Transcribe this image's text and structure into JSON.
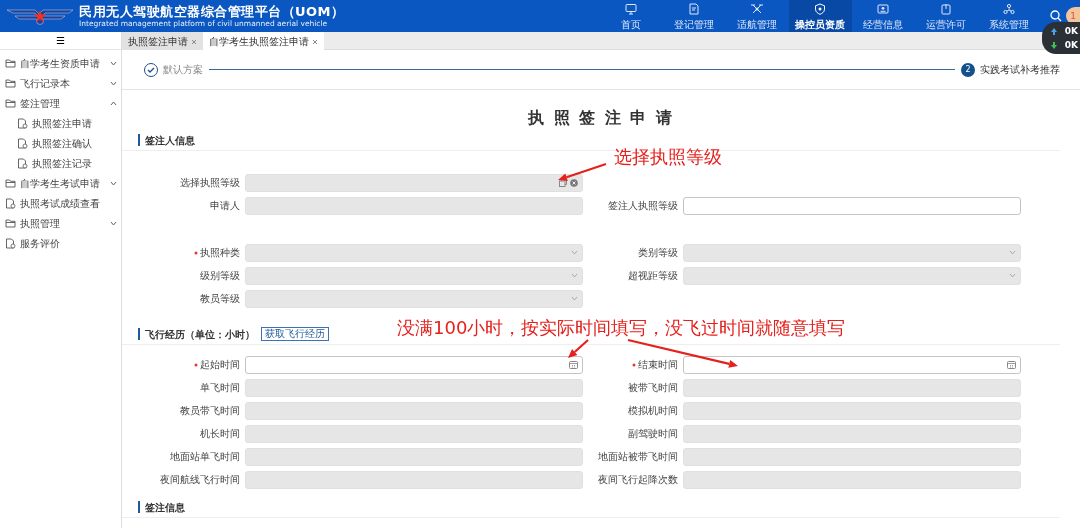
{
  "header": {
    "title": "民用无人驾驶航空器综合管理平台（UOM）",
    "subtitle": "Integrated management platform of civil unmanned aerial vehicle",
    "nav": [
      {
        "label": "首页",
        "selected": false
      },
      {
        "label": "登记管理",
        "selected": false
      },
      {
        "label": "适航管理",
        "selected": false
      },
      {
        "label": "操控员资质",
        "selected": true
      },
      {
        "label": "经营信息",
        "selected": false
      },
      {
        "label": "运营许可",
        "selected": false
      },
      {
        "label": "系统管理",
        "selected": false
      }
    ],
    "avatar": "1",
    "speed": [
      {
        "kind": "up",
        "text": "0K"
      },
      {
        "kind": "down",
        "text": "0K"
      }
    ]
  },
  "tabs": [
    {
      "label": "执照签注申请",
      "selected": false
    },
    {
      "label": "自学考生执照签注申请",
      "selected": true
    }
  ],
  "sidebar": {
    "menu_icon": "☰",
    "items": [
      {
        "label": "自学考生资质申请",
        "kind": "folder",
        "expanded": false
      },
      {
        "label": "飞行记录本",
        "kind": "folder",
        "expanded": false
      },
      {
        "label": "签注管理",
        "kind": "folder",
        "expanded": true,
        "children": [
          {
            "label": "执照签注申请",
            "kind": "page"
          },
          {
            "label": "执照签注确认",
            "kind": "page"
          },
          {
            "label": "执照签注记录",
            "kind": "page"
          }
        ]
      },
      {
        "label": "自学考生考试申请",
        "kind": "folder",
        "expanded": false
      },
      {
        "label": "执照考试成绩查看",
        "kind": "page"
      },
      {
        "label": "执照管理",
        "kind": "folder",
        "expanded": false
      },
      {
        "label": "服务评价",
        "kind": "page"
      }
    ]
  },
  "steps": [
    {
      "label": "默认方案",
      "completed": true
    },
    {
      "number": "2",
      "label": "实践考试补考推荐",
      "completed": false
    }
  ],
  "form_title": "执 照 签 注 申 请",
  "sections": [
    {
      "title": "签注人信息",
      "groups": [
        [
          [
            {
              "label": "选择执照等级",
              "kind": "picker",
              "required": false,
              "disabled": true
            }
          ],
          [
            {
              "label": "申请人",
              "kind": "text",
              "required": false,
              "disabled": true
            },
            {
              "label": "签注人执照等级",
              "kind": "text",
              "required": false,
              "disabled": false
            }
          ]
        ],
        [
          [
            {
              "label": "执照种类",
              "kind": "select",
              "required": true,
              "disabled": true
            },
            {
              "label": "类别等级",
              "kind": "select",
              "required": false,
              "disabled": true
            }
          ],
          [
            {
              "label": "级别等级",
              "kind": "select",
              "required": false,
              "disabled": true
            },
            {
              "label": "超视距等级",
              "kind": "select",
              "required": false,
              "disabled": true
            }
          ],
          [
            {
              "label": "教员等级",
              "kind": "select",
              "required": false,
              "disabled": true
            }
          ]
        ]
      ]
    },
    {
      "title": "飞行经历（单位：小时）",
      "button": "获取飞行经历",
      "groups": [
        [
          [
            {
              "label": "起始时间",
              "kind": "date",
              "required": true,
              "disabled": false
            },
            {
              "label": "结束时间",
              "kind": "date",
              "required": true,
              "disabled": false
            }
          ],
          [
            {
              "label": "单飞时间",
              "kind": "text",
              "required": false,
              "disabled": true
            },
            {
              "label": "被带飞时间",
              "kind": "text",
              "required": false,
              "disabled": true
            }
          ],
          [
            {
              "label": "教员带飞时间",
              "kind": "text",
              "required": false,
              "disabled": true
            },
            {
              "label": "模拟机时间",
              "kind": "text",
              "required": false,
              "disabled": true
            }
          ],
          [
            {
              "label": "机长时间",
              "kind": "text",
              "required": false,
              "disabled": true
            },
            {
              "label": "副驾驶时间",
              "kind": "text",
              "required": false,
              "disabled": true
            }
          ],
          [
            {
              "label": "地面站单飞时间",
              "kind": "text",
              "required": false,
              "disabled": true
            },
            {
              "label": "地面站被带飞时间",
              "kind": "text",
              "required": false,
              "disabled": true
            }
          ],
          [
            {
              "label": "夜间航线飞行时间",
              "kind": "text",
              "required": false,
              "disabled": true
            },
            {
              "label": "夜间飞行起降次数",
              "kind": "text",
              "required": false,
              "disabled": true
            }
          ]
        ]
      ]
    },
    {
      "title": "签注信息"
    }
  ],
  "annotations": [
    {
      "text": "选择执照等级"
    },
    {
      "text": "没满100小时，按实际时间填写，没飞过时间就随意填写"
    }
  ]
}
